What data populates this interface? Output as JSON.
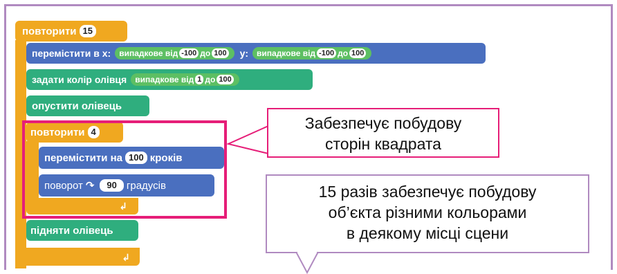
{
  "blocks": {
    "repeat_outer_label": "повторити",
    "repeat_outer_count": "15",
    "goto_label": "перемістити в x:",
    "random_label": "випадкове від",
    "x_from": "-100",
    "to_label": "до",
    "x_to": "100",
    "y_label": "y:",
    "y_from": "-100",
    "y_to": "100",
    "set_color_label": "задати колір олівця",
    "color_from": "1",
    "color_to": "100",
    "pen_down_label": "опустити олівець",
    "repeat_inner_label": "повторити",
    "repeat_inner_count": "4",
    "move_label": "перемістити на",
    "move_steps": "100",
    "steps_label": "кроків",
    "turn_label": "поворот",
    "turn_degrees": "90",
    "degrees_label": "градусів",
    "pen_up_label": "підняти олівець"
  },
  "callouts": {
    "square_line1": "Забезпечує побудову",
    "square_line2": "сторін квадрата",
    "repeat_line1": "15 разів забезпечує побудову",
    "repeat_line2": "об’єкта різними кольорами",
    "repeat_line3": "в деякому місці сцени"
  },
  "colors": {
    "control": "#f0a820",
    "motion": "#4a6fbf",
    "pen": "#2fae7e",
    "operator": "#5dbf63",
    "highlight": "#e61e78",
    "callout_border": "#b08ac0"
  }
}
